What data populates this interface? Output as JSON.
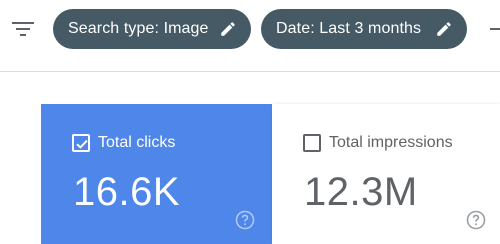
{
  "filters": {
    "chips": [
      {
        "label": "Search type: Image"
      },
      {
        "label": "Date: Last 3 months"
      }
    ]
  },
  "metrics": {
    "clicks": {
      "label": "Total clicks",
      "value": "16.6K",
      "checked": true
    },
    "impressions": {
      "label": "Total impressions",
      "value": "12.3M",
      "checked": false
    }
  },
  "colors": {
    "chip_bg": "#455a64",
    "clicks_card_bg": "#4e86ea",
    "impressions_text": "#5f6368"
  },
  "icons": {
    "filter": "filter-list-icon",
    "edit": "pencil-icon",
    "help": "help-circle-icon"
  }
}
